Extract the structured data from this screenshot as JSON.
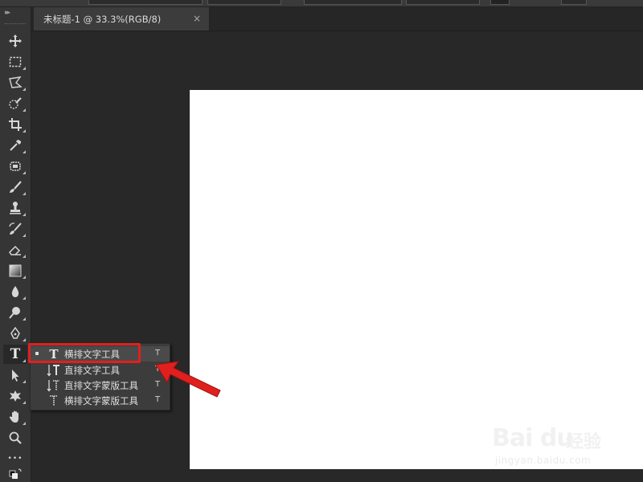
{
  "document_tab": {
    "title": "未标题-1 @ 33.3%(RGB/8)",
    "close_glyph": "×"
  },
  "toolbar": {
    "tools": [
      {
        "name": "move-tool",
        "icon": "move-icon"
      },
      {
        "name": "marquee-tool",
        "icon": "rect-marquee-icon"
      },
      {
        "name": "lasso-tool",
        "icon": "polygon-lasso-icon"
      },
      {
        "name": "quick-select-tool",
        "icon": "quick-select-icon"
      },
      {
        "name": "crop-tool",
        "icon": "crop-icon"
      },
      {
        "name": "eyedropper-tool",
        "icon": "eyedropper-icon"
      },
      {
        "name": "healing-tool",
        "icon": "healing-brush-icon"
      },
      {
        "name": "brush-tool",
        "icon": "brush-icon"
      },
      {
        "name": "stamp-tool",
        "icon": "clone-stamp-icon"
      },
      {
        "name": "history-brush-tool",
        "icon": "history-brush-icon"
      },
      {
        "name": "eraser-tool",
        "icon": "eraser-icon"
      },
      {
        "name": "gradient-tool",
        "icon": "gradient-icon"
      },
      {
        "name": "blur-tool",
        "icon": "blur-drop-icon"
      },
      {
        "name": "dodge-tool",
        "icon": "dodge-icon"
      },
      {
        "name": "pen-tool",
        "icon": "pen-icon"
      },
      {
        "name": "type-tool",
        "icon": "type-icon",
        "label": "T"
      },
      {
        "name": "path-select-tool",
        "icon": "arrow-select-icon"
      },
      {
        "name": "shape-tool",
        "icon": "custom-shape-icon"
      },
      {
        "name": "hand-tool",
        "icon": "hand-icon"
      },
      {
        "name": "zoom-tool",
        "icon": "zoom-icon"
      },
      {
        "name": "more-tools",
        "icon": "ellipsis-icon",
        "label": "•••"
      }
    ]
  },
  "type_flyout": {
    "items": [
      {
        "label": "横排文字工具",
        "shortcut": "T",
        "selected": true,
        "icon": "horizontal-type-icon"
      },
      {
        "label": "直排文字工具",
        "shortcut": "T",
        "selected": false,
        "icon": "vertical-type-icon"
      },
      {
        "label": "直排文字蒙版工具",
        "shortcut": "T",
        "selected": false,
        "icon": "vertical-type-mask-icon"
      },
      {
        "label": "横排文字蒙版工具",
        "shortcut": "T",
        "selected": false,
        "icon": "horizontal-type-mask-icon"
      }
    ]
  },
  "watermark": {
    "logo": "Bai du",
    "cn": "经验",
    "url": "jingyan.baidu.com"
  },
  "colors": {
    "annotation_red": "#e0201e",
    "canvas": "#ffffff",
    "workspace": "#282828",
    "panel": "#353535"
  }
}
